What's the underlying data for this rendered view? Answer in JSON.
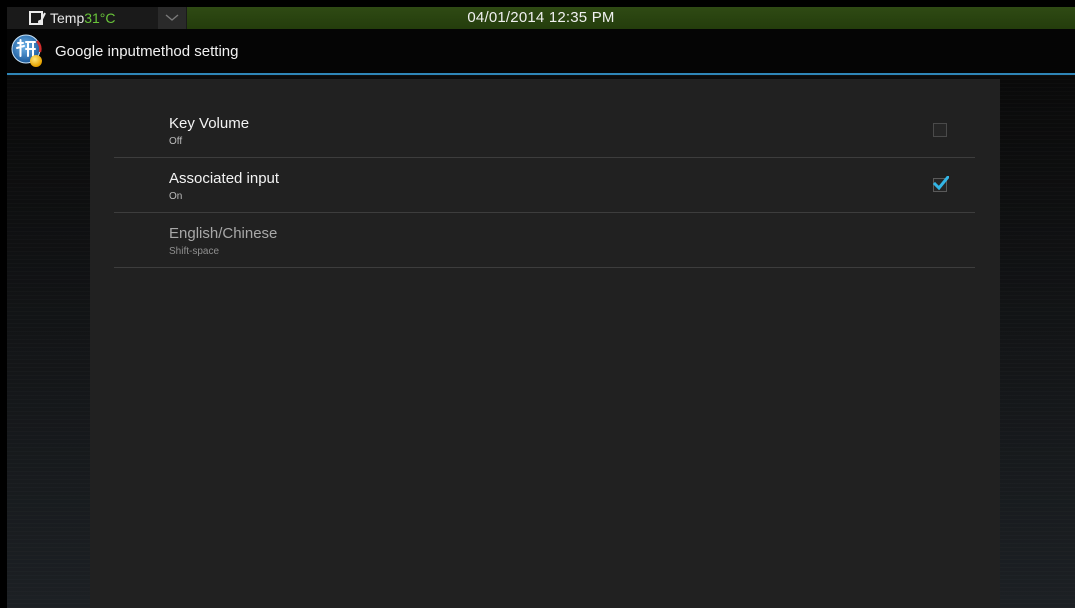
{
  "status_bar": {
    "temp_label": "Temp",
    "temp_value": "31°C",
    "datetime": "04/01/2014 12:35 PM",
    "icons": [
      "thermometer-icon",
      "chevron-down-icon"
    ],
    "colors": {
      "bar": "#2f4a14",
      "temp_value": "#69c43a"
    }
  },
  "action_bar": {
    "title": "Google inputmethod setting",
    "icon": "pinyin-app-icon",
    "accent": "#2f86b8"
  },
  "preferences": [
    {
      "title": "Key Volume",
      "summary": "Off",
      "checkbox": true,
      "checked": false
    },
    {
      "title": "Associated input",
      "summary": "On",
      "checkbox": true,
      "checked": true
    },
    {
      "title": "English/Chinese",
      "summary": "Shift-space",
      "checkbox": false,
      "enabled": false
    }
  ],
  "colors": {
    "check_accent": "#33b5e5",
    "panel": "#212121",
    "divider": "#3d3d3d"
  }
}
